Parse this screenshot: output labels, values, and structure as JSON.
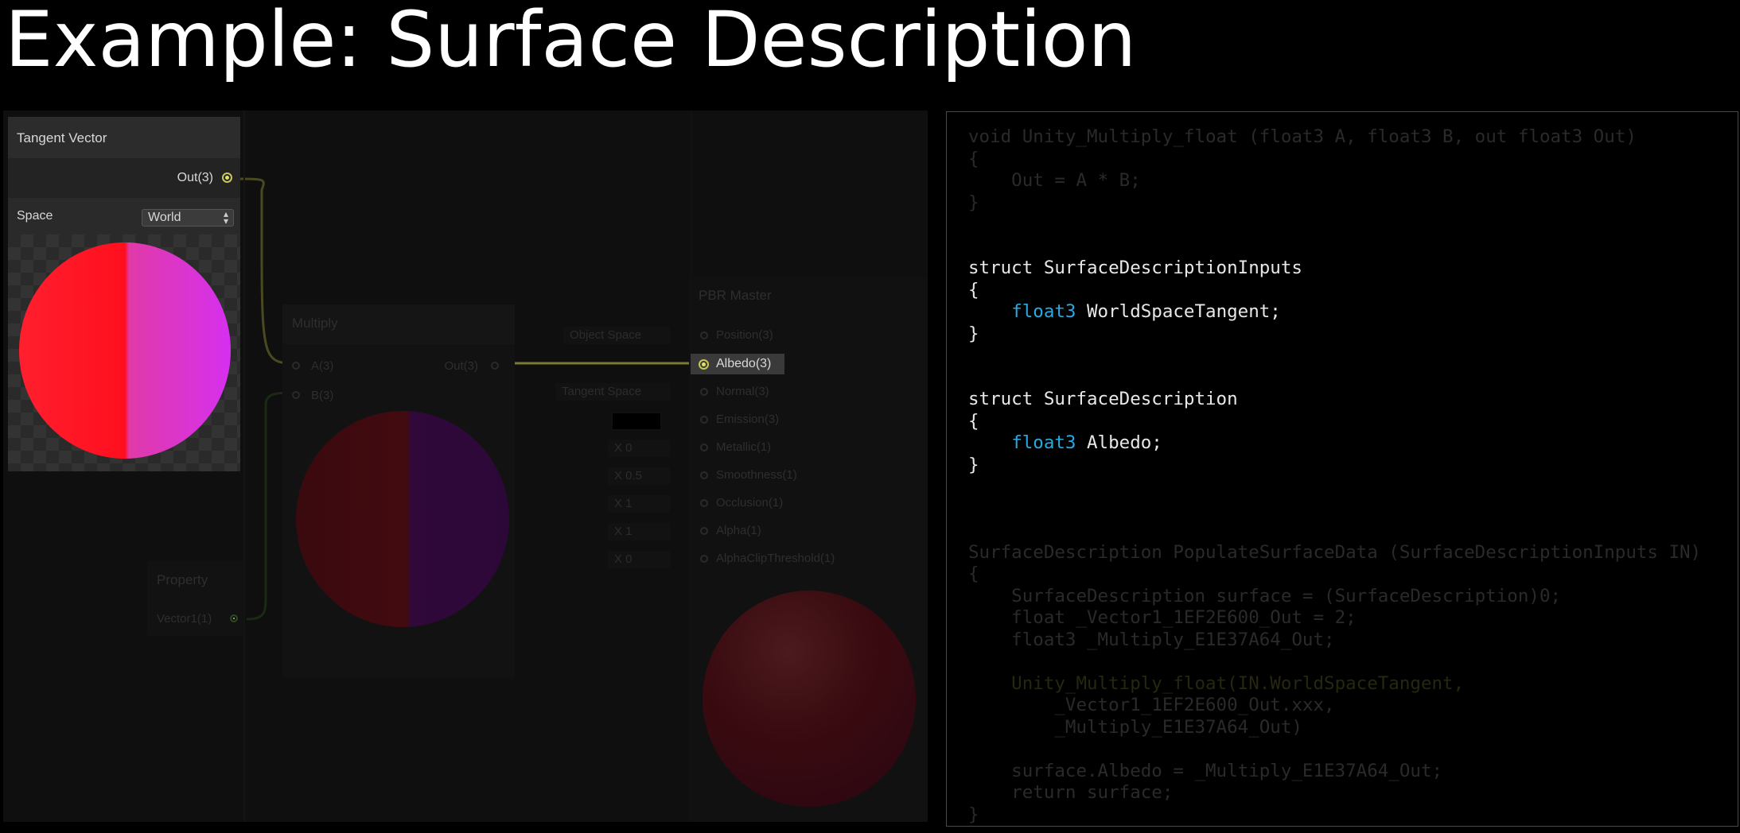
{
  "title": "Example: Surface Description",
  "tangent_node": {
    "title": "Tangent Vector",
    "out_port": "Out(3)",
    "space_label": "Space",
    "space_value": "World"
  },
  "multiply_node": {
    "title": "Multiply",
    "in_a": "A(3)",
    "in_b": "B(3)",
    "out_port": "Out(3)"
  },
  "property_node": {
    "title": "Property",
    "out_port": "Vector1(1)"
  },
  "pbr_node": {
    "title": "PBR Master",
    "ports": [
      {
        "label": "Position(3)",
        "field": "Object Space"
      },
      {
        "label": "Albedo(3)",
        "field": ""
      },
      {
        "label": "Normal(3)",
        "field": "Tangent Space"
      },
      {
        "label": "Emission(3)",
        "field": ""
      },
      {
        "label": "Metallic(1)",
        "field": "X 0"
      },
      {
        "label": "Smoothness(1)",
        "field": "X 0.5"
      },
      {
        "label": "Occlusion(1)",
        "field": "X 1"
      },
      {
        "label": "Alpha(1)",
        "field": "X 1"
      },
      {
        "label": "AlphaClipThreshold(1)",
        "field": "X 0"
      }
    ]
  },
  "colors": {
    "background": "#000000",
    "keyword": "#2aa8e0",
    "text": "#e8e8e8",
    "connection": "#9e9e42"
  },
  "icons": [
    "chevron-updown-icon",
    "port-dot-icon"
  ],
  "code_lines": {
    "l1": "void Unity_Multiply_float (float3 A, float3 B, out float3 Out)",
    "l2": "{",
    "l3": "    Out = A * B;",
    "l4": "}",
    "l5": "struct SurfaceDescriptionInputs",
    "l6": "{",
    "l7": "float3",
    "l7b": " WorldSpaceTangent;",
    "l8": "}",
    "l9": "struct SurfaceDescription",
    "l10": "{",
    "l11": "float3",
    "l11b": " Albedo;",
    "l12": "}",
    "l13": "SurfaceDescription PopulateSurfaceData (SurfaceDescriptionInputs IN)",
    "l14": "{",
    "l15": "    SurfaceDescription surface = (SurfaceDescription)0;",
    "l16": "    float _Vector1_1EF2E600_Out = 2;",
    "l17": "    float3 _Multiply_E1E37A64_Out;",
    "l18": "    Unity_Multiply_float(IN.WorldSpaceTangent,",
    "l19": "        _Vector1_1EF2E600_Out.xxx,",
    "l20": "        _Multiply_E1E37A64_Out)",
    "l21": "    surface.Albedo = _Multiply_E1E37A64_Out;",
    "l22": "    return surface;",
    "l23": "}"
  }
}
